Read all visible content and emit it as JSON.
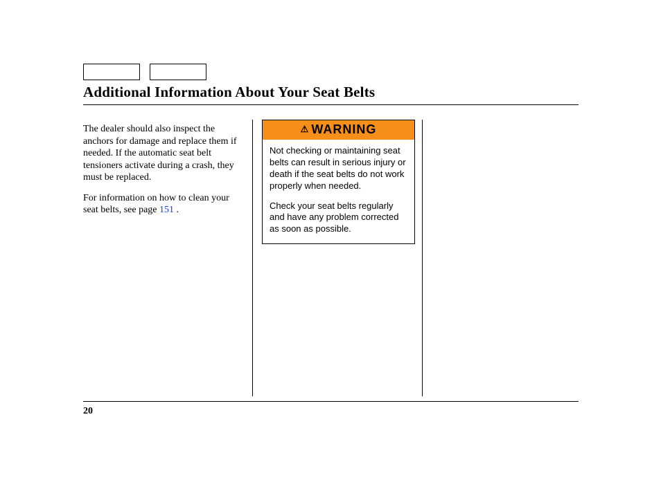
{
  "heading": "Additional Information About Your Seat Belts",
  "col1": {
    "p1": "The dealer should also inspect the anchors for damage and replace them if needed. If the automatic seat belt tensioners activate during a crash, they must be replaced.",
    "p2_a": "For information on how to clean your seat belts, see page ",
    "p2_link": "151",
    "p2_b": " ."
  },
  "warning": {
    "label": "WARNING",
    "p1": "Not checking or maintaining seat belts can result in serious injury or death if the seat belts do not work properly when needed.",
    "p2": "Check your seat belts regularly and have any problem corrected as soon as possible."
  },
  "page_number": "20"
}
